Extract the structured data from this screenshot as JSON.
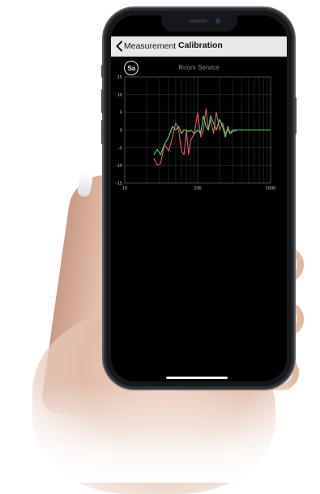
{
  "nav": {
    "back_label": "Measurement",
    "title": "Calibration"
  },
  "logo": {
    "text": "Sa"
  },
  "icons": {
    "back": "chevron-left-icon",
    "logo": "sa-logo-icon"
  },
  "colors": {
    "series_red": "#e05a6a",
    "series_green": "#5fd86a",
    "grid": "#3a3a3a",
    "axis_text": "#c8c8c8"
  },
  "chart_data": {
    "type": "line",
    "title": "Room Service",
    "x_scale": "log",
    "xlim": [
      10,
      1000
    ],
    "ylim": [
      -15,
      15
    ],
    "x_ticks": [
      10,
      100,
      1000
    ],
    "y_ticks": [
      15,
      10,
      5,
      0,
      -5,
      -10,
      -15
    ],
    "grid": true,
    "series": [
      {
        "color": "red",
        "x": [
          25,
          28,
          31,
          35,
          40,
          45,
          50,
          55,
          60,
          65,
          70,
          75,
          80,
          90,
          100,
          110,
          120,
          130,
          140,
          150,
          165,
          180,
          200,
          220,
          240,
          260,
          280,
          300,
          350,
          400,
          500,
          700,
          1000
        ],
        "y": [
          -8,
          -10,
          -9.5,
          -4,
          -6,
          -2,
          2,
          0,
          -6,
          -7,
          0,
          -7,
          -3,
          -1,
          5,
          -2,
          0,
          6,
          0,
          3,
          -1,
          5,
          0,
          2,
          -1,
          0,
          -1,
          -0.5,
          0,
          0,
          0,
          0,
          0
        ]
      },
      {
        "color": "green",
        "x": [
          25,
          28,
          31,
          35,
          40,
          45,
          50,
          55,
          60,
          65,
          70,
          75,
          80,
          90,
          100,
          110,
          120,
          130,
          140,
          150,
          165,
          180,
          200,
          220,
          240,
          260,
          280,
          300,
          350,
          400,
          500,
          700,
          1000
        ],
        "y": [
          -7,
          -5.5,
          -7,
          -4,
          -2,
          1,
          0,
          1,
          -1,
          0,
          0,
          -0.5,
          0,
          -1,
          0,
          -1,
          4,
          1,
          0,
          4,
          2,
          0,
          3,
          1,
          -2,
          1,
          -1,
          0,
          0,
          0,
          0,
          0,
          0
        ]
      }
    ]
  }
}
